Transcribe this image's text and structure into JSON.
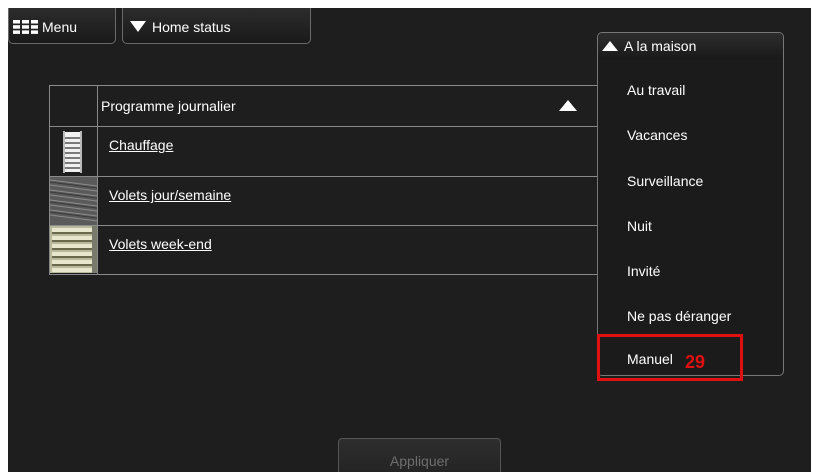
{
  "topbar": {
    "menu_label": "Menu",
    "status_label": "Home status"
  },
  "table": {
    "header": "Programme journalier",
    "rows": [
      {
        "label": "Chauffage",
        "thumb": "radiator-icon"
      },
      {
        "label": "Volets jour/semaine",
        "thumb": "blinds-dark-icon"
      },
      {
        "label": "Volets week-end",
        "thumb": "blinds-light-icon"
      }
    ]
  },
  "dropdown": {
    "selected": "A la maison",
    "options": [
      "Au travail",
      "Vacances",
      "Surveillance",
      "Nuit",
      "Invité",
      "Ne pas déranger",
      "Manuel"
    ]
  },
  "annotation": {
    "number": "29",
    "color": "#e01010"
  },
  "apply_label": "Appliquer",
  "colors": {
    "background": "#1e1e1e",
    "border": "#8a8a8a",
    "text": "#ffffff",
    "disabled_text": "#6e6e6e"
  }
}
